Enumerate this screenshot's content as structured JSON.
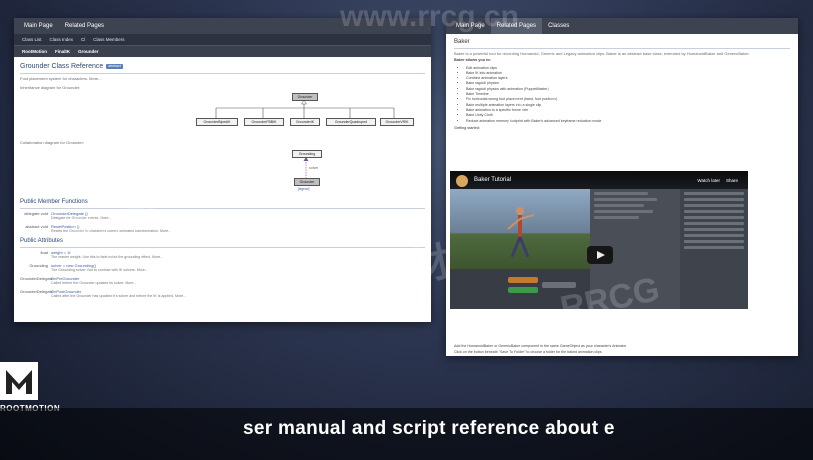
{
  "left_window": {
    "nav": [
      "Main Page",
      "Related Pages"
    ],
    "subnav": [
      "Class List",
      "Class Index",
      "Cl",
      "Class Members"
    ],
    "crumbs": [
      "RootMotion",
      "FinalIK",
      "Grounder"
    ],
    "title": "Grounder Class Reference",
    "title_badge": "abstract",
    "intro": "Foot placement system for characters. More...",
    "inherit_label": "Inheritance diagram for Grounder:",
    "diagram_root": "Grounder",
    "diagram_children": [
      "GrounderBipedIK",
      "GrounderFBBIK",
      "GrounderIK",
      "GrounderQuadruped",
      "GrounderVRIK"
    ],
    "collab_label": "Collaboration diagram for Grounder:",
    "collab_top": "Grounding",
    "collab_edge": "solver",
    "collab_bottom": "Grounder",
    "legend": "[legend]",
    "section_functions": "Public Member Functions",
    "functions": [
      {
        "type": "delegate void",
        "name": "GrounderDelegate ()",
        "desc": "Delegate for Grounder events. More..."
      },
      {
        "type": "abstract void",
        "name": "ResetPosition ()",
        "desc": "Resets the Grounder to characters current animated transformation. More..."
      }
    ],
    "section_attributes": "Public Attributes",
    "attributes": [
      {
        "type": "float",
        "name": "weight = 1f",
        "desc": "The master weight. Use this to fade in/out the grounding effect. More..."
      },
      {
        "type": "Grounding",
        "name": "solver = new Grounding()",
        "desc": "The Grounding solver. Not to confuse with IK solvers. More..."
      },
      {
        "type": "GrounderDelegate",
        "name": "OnPreGrounder",
        "desc": "Called before the Grounder updates its solver. More..."
      },
      {
        "type": "GrounderDelegate",
        "name": "OnPostGrounder",
        "desc": "Called after the Grounder has updated it's solver and before the IK is applied. More..."
      }
    ]
  },
  "right_window": {
    "nav": [
      "Main Page",
      "Related Pages",
      "Classes"
    ],
    "title": "Baker",
    "intro": "Baker is a powerful tool for recording Humanoid, Generic and Legacy animation clips. Baker is an abstract base class, extended by HumanoidBaker and GenericBaker.",
    "allows_label": "Baker allows you to:",
    "bullets": [
      "Edit animation clips",
      "Bake IK into animation",
      "Combine animation layers",
      "Bake ragdoll physics",
      "Bake ragdoll physics with animation (PuppetMaster)",
      "Bake Timeline",
      "Fix horizontal wrong foot placement (hand, foot positions)",
      "Bake multiple animation layers into a single clip",
      "Bake animation to a specific frame rate",
      "Bake Unity Cloth",
      "Reduce animation memory footprint with Baker's advanced keyframe reduction mode"
    ],
    "getting_started": "Getting started:",
    "video_title": "Baker Tutorial",
    "video_watch_later": "Watch later",
    "video_share": "Share",
    "after_video": [
      "Add the HumanoidBaker or GenericBaker component to the same GameObject as your character's Animator",
      "Click on the button beneath \"Save To Folder\" to choose a folder for the baked animation clips"
    ]
  },
  "overlay": {
    "brand_text": "ROOTMOTION",
    "subtitle": "ser manual and script reference about e",
    "watermarks": [
      "RRCG",
      "人人素材",
      "www.rrcg.cn"
    ]
  }
}
